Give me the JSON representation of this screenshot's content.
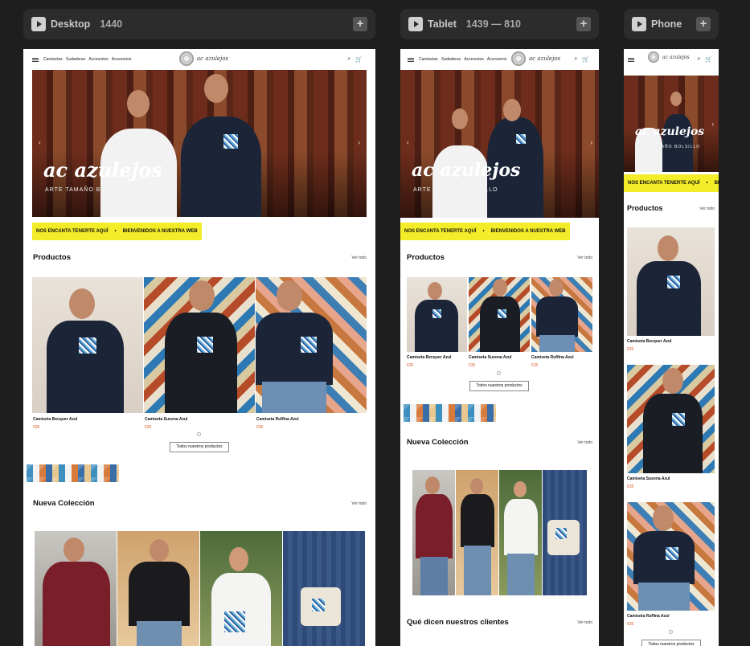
{
  "frames": {
    "desktop": {
      "name": "Desktop",
      "size": "1440"
    },
    "tablet": {
      "name": "Tablet",
      "size": "1439 — 810"
    },
    "phone": {
      "name": "Phone",
      "size": ""
    }
  },
  "nav": {
    "links": [
      "Camisetas",
      "Sudaderas",
      "Accesorios",
      "Accesorios"
    ],
    "logo": "ac azulejos"
  },
  "hero": {
    "title": "ac azulejos",
    "subtitle": "ARTE TAMAÑO BOLSILLO"
  },
  "marquee": {
    "item1": "NOS ENCANTA TENERTE  AQUÍ",
    "sep": "•",
    "item2": "BIENVENIDOS A NUESTRA WEB"
  },
  "products": {
    "title": "Productos",
    "view_all": "Ver todo",
    "items": [
      {
        "name": "Camiseta Becquer Azul",
        "price": "€35"
      },
      {
        "name": "Camiseta Susona Azul",
        "price": "€35"
      },
      {
        "name": "Camiseta Ruffina Azul",
        "price": "€35"
      }
    ],
    "button": "Todos nuestros productos"
  },
  "collection": {
    "title": "Nueva Colección",
    "view_all": "Ver todo"
  },
  "testimonials": {
    "title": "Qué dicen nuestros clientes",
    "view_all": "Ver todo"
  },
  "colors": {
    "accent": "#f3ec28",
    "price": "#e05a2a",
    "canvas": "#1e1e1e"
  }
}
